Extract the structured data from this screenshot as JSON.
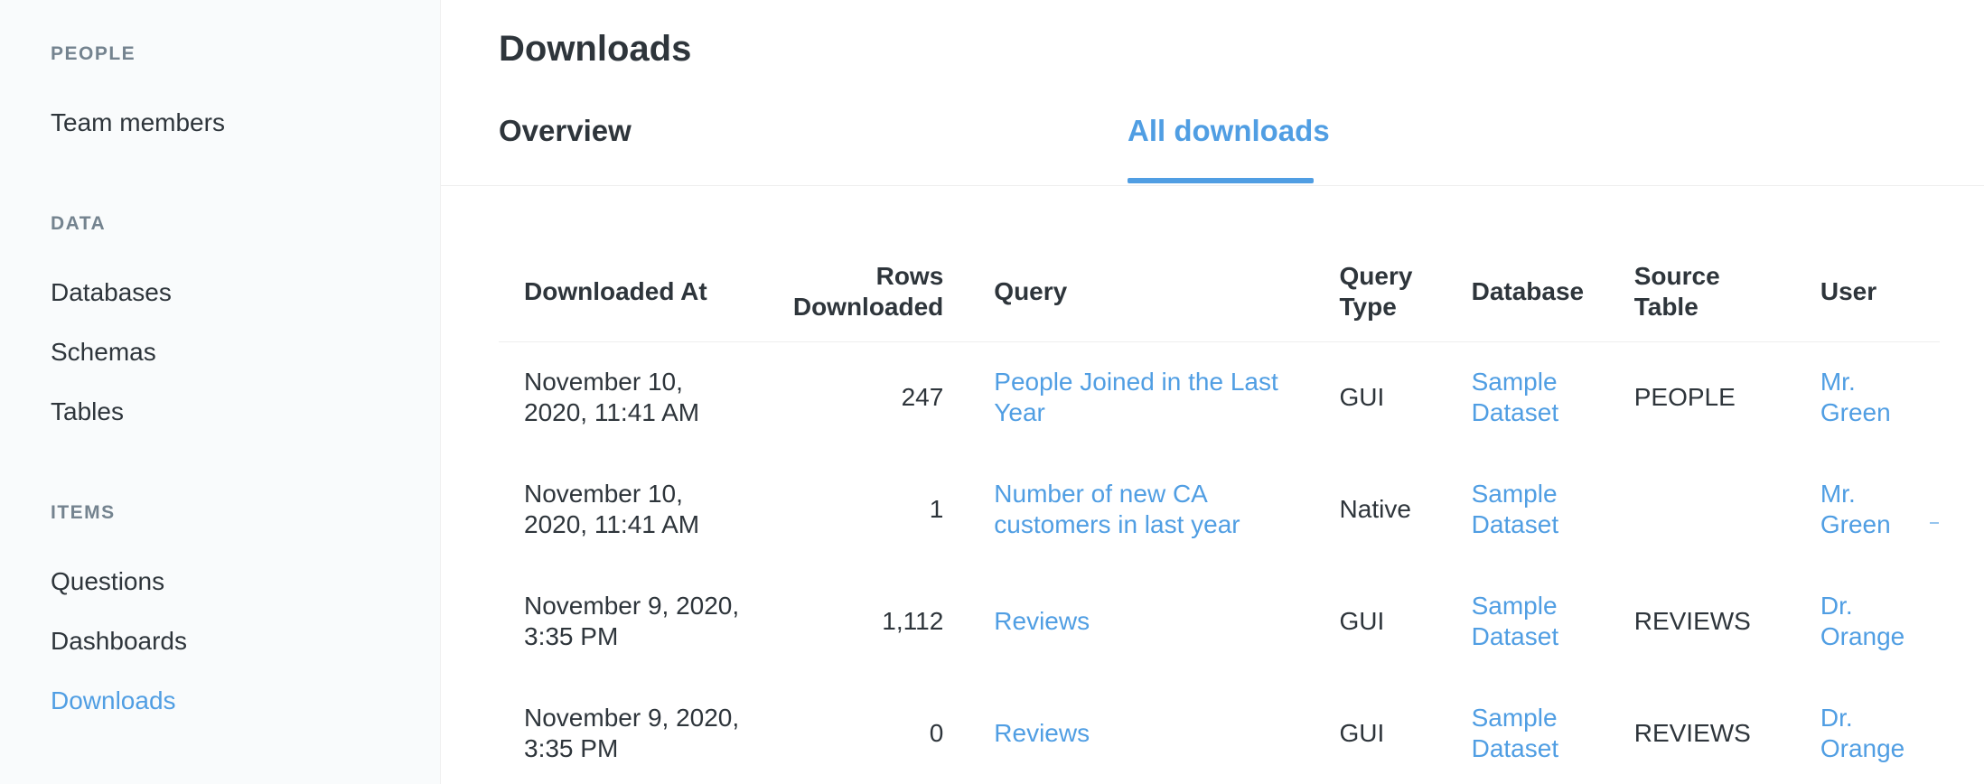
{
  "sidebar": {
    "sections": [
      {
        "title": "PEOPLE",
        "items": [
          {
            "label": "Team members",
            "active": false
          }
        ]
      },
      {
        "title": "DATA",
        "items": [
          {
            "label": "Databases",
            "active": false
          },
          {
            "label": "Schemas",
            "active": false
          },
          {
            "label": "Tables",
            "active": false
          }
        ]
      },
      {
        "title": "ITEMS",
        "items": [
          {
            "label": "Questions",
            "active": false
          },
          {
            "label": "Dashboards",
            "active": false
          },
          {
            "label": "Downloads",
            "active": true
          }
        ]
      }
    ]
  },
  "main": {
    "title": "Downloads",
    "tabs": [
      {
        "label": "Overview",
        "active": false
      },
      {
        "label": "All downloads",
        "active": true
      }
    ],
    "table": {
      "columns": [
        {
          "line1": "Downloaded At",
          "line2": ""
        },
        {
          "line1": "Rows",
          "line2": "Downloaded"
        },
        {
          "line1": "Query",
          "line2": ""
        },
        {
          "line1": "Query",
          "line2": "Type"
        },
        {
          "line1": "Database",
          "line2": ""
        },
        {
          "line1": "Source",
          "line2": "Table"
        },
        {
          "line1": "User",
          "line2": ""
        }
      ],
      "rows": [
        {
          "downloaded_at_1": "November 10,",
          "downloaded_at_2": "2020, 11:41 AM",
          "rows": "247",
          "query_1": "People Joined in the Last",
          "query_2": "Year",
          "query_type": "GUI",
          "database_1": "Sample",
          "database_2": "Dataset",
          "source_table": "PEOPLE",
          "user_1": "Mr.",
          "user_2": "Green"
        },
        {
          "downloaded_at_1": "November 10,",
          "downloaded_at_2": "2020, 11:41 AM",
          "rows": "1",
          "query_1": "Number of new CA",
          "query_2": "customers in last year",
          "query_type": "Native",
          "database_1": "Sample",
          "database_2": "Dataset",
          "source_table": "",
          "user_1": "Mr.",
          "user_2": "Green"
        },
        {
          "downloaded_at_1": "November 9, 2020,",
          "downloaded_at_2": "3:35 PM",
          "rows": "1,112",
          "query_1": "Reviews",
          "query_2": "",
          "query_type": "GUI",
          "database_1": "Sample",
          "database_2": "Dataset",
          "source_table": "REVIEWS",
          "user_1": "Dr.",
          "user_2": "Orange"
        },
        {
          "downloaded_at_1": "November 9, 2020,",
          "downloaded_at_2": "3:35 PM",
          "rows": "0",
          "query_1": "Reviews",
          "query_2": "",
          "query_type": "GUI",
          "database_1": "Sample",
          "database_2": "Dataset",
          "source_table": "REVIEWS",
          "user_1": "Dr.",
          "user_2": "Orange"
        }
      ]
    }
  },
  "colors": {
    "accent": "#509ee3",
    "text": "#2e353b",
    "muted": "#74838f",
    "sidebar_bg": "#f9fbfc"
  }
}
